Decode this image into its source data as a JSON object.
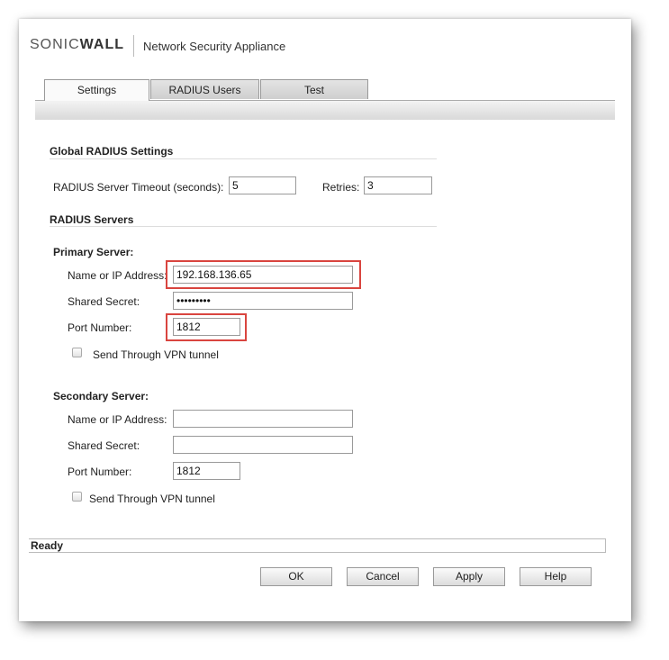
{
  "header": {
    "brand_left": "SONIC",
    "brand_right": "WALL",
    "app_name": "Network Security Appliance"
  },
  "tabs": [
    {
      "label": "Settings"
    },
    {
      "label": "RADIUS Users"
    },
    {
      "label": "Test"
    }
  ],
  "global": {
    "title": "Global RADIUS Settings",
    "timeout_label": "RADIUS Server Timeout (seconds):",
    "timeout_value": "5",
    "retries_label": "Retries:",
    "retries_value": "3"
  },
  "servers": {
    "title": "RADIUS Servers",
    "primary": {
      "title": "Primary Server:",
      "name_label": "Name or IP Address:",
      "name_value": "192.168.136.65",
      "secret_label": "Shared Secret:",
      "secret_value": "•••••••••",
      "port_label": "Port Number:",
      "port_value": "1812",
      "vpn_label": "Send Through VPN tunnel"
    },
    "secondary": {
      "title": "Secondary Server:",
      "name_label": "Name or IP Address:",
      "name_value": "",
      "secret_label": "Shared Secret:",
      "secret_value": "",
      "port_label": "Port Number:",
      "port_value": "1812",
      "vpn_label": "Send Through VPN tunnel"
    }
  },
  "status": {
    "text": "Ready"
  },
  "buttons": {
    "ok": "OK",
    "cancel": "Cancel",
    "apply": "Apply",
    "help": "Help"
  },
  "colors": {
    "highlight": "#d9453f"
  }
}
